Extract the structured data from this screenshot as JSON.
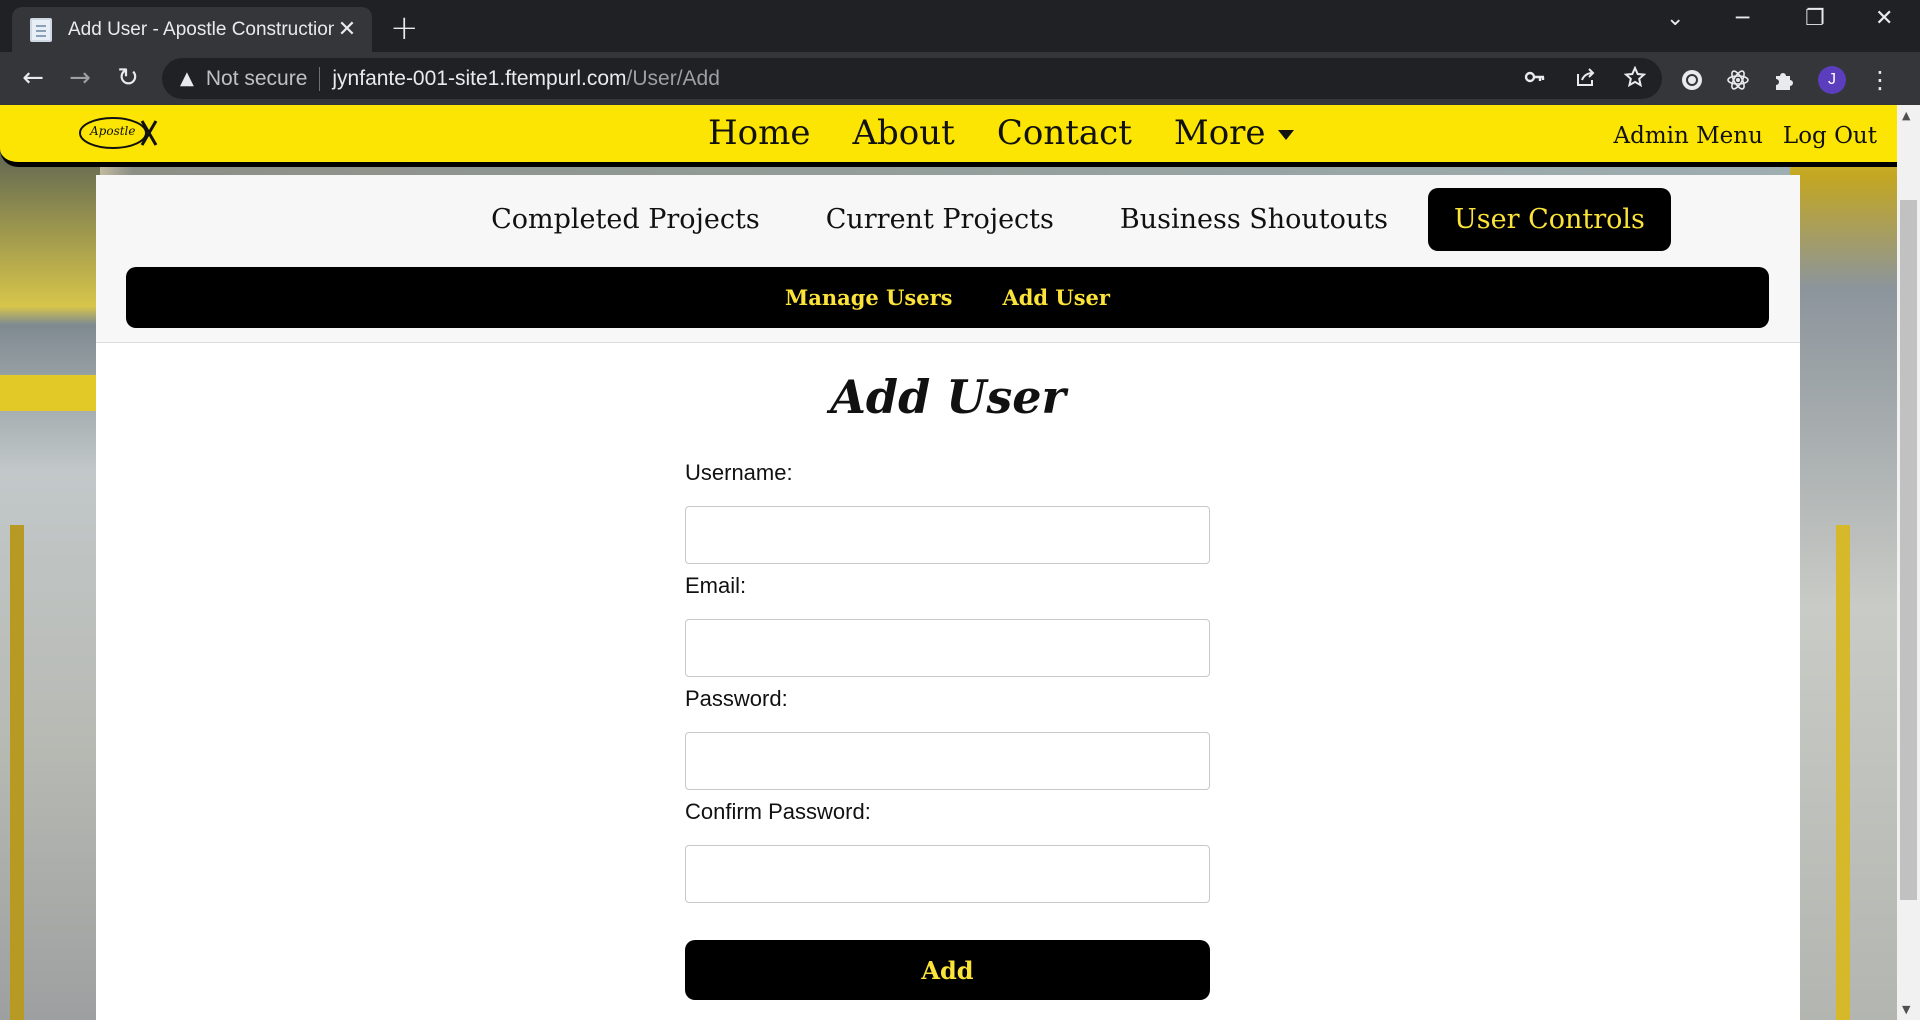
{
  "browser": {
    "tab_title": "Add User - Apostle Construction",
    "tab_close": "✕",
    "new_tab": "+",
    "window_controls": [
      "⌄",
      "─",
      "❐",
      "✕"
    ],
    "nav": {
      "back": "←",
      "forward": "→",
      "reload": "↻"
    },
    "security_warning_icon": "▲",
    "security_text": "Not secure",
    "url_host": "jynfante-001-site1.ftempurl.com",
    "url_path": "/User/Add",
    "omnibox_icons": [
      "key-icon",
      "share-icon",
      "star-icon"
    ],
    "extension_icons": [
      "extension-a-icon",
      "react-icon",
      "puzzle-icon"
    ],
    "profile_initial": "J",
    "menu": "⋮"
  },
  "site": {
    "logo_text": "Apostle",
    "nav": {
      "home": "Home",
      "about": "About",
      "contact": "Contact",
      "more": "More"
    },
    "admin_menu": "Admin Menu",
    "log_out": "Log Out"
  },
  "sub_nav": {
    "completed": "Completed Projects",
    "current": "Current Projects",
    "shoutouts": "Business Shoutouts",
    "user_controls": "User Controls"
  },
  "sub_bar": {
    "manage_users": "Manage Users",
    "add_user": "Add User"
  },
  "form": {
    "title": "Add User",
    "username_label": "Username:",
    "email_label": "Email:",
    "password_label": "Password:",
    "confirm_label": "Confirm Password:",
    "submit_label": "Add"
  },
  "colors": {
    "brand_yellow": "#fce502",
    "accent_text": "#fbe33a",
    "dark": "#000000"
  }
}
